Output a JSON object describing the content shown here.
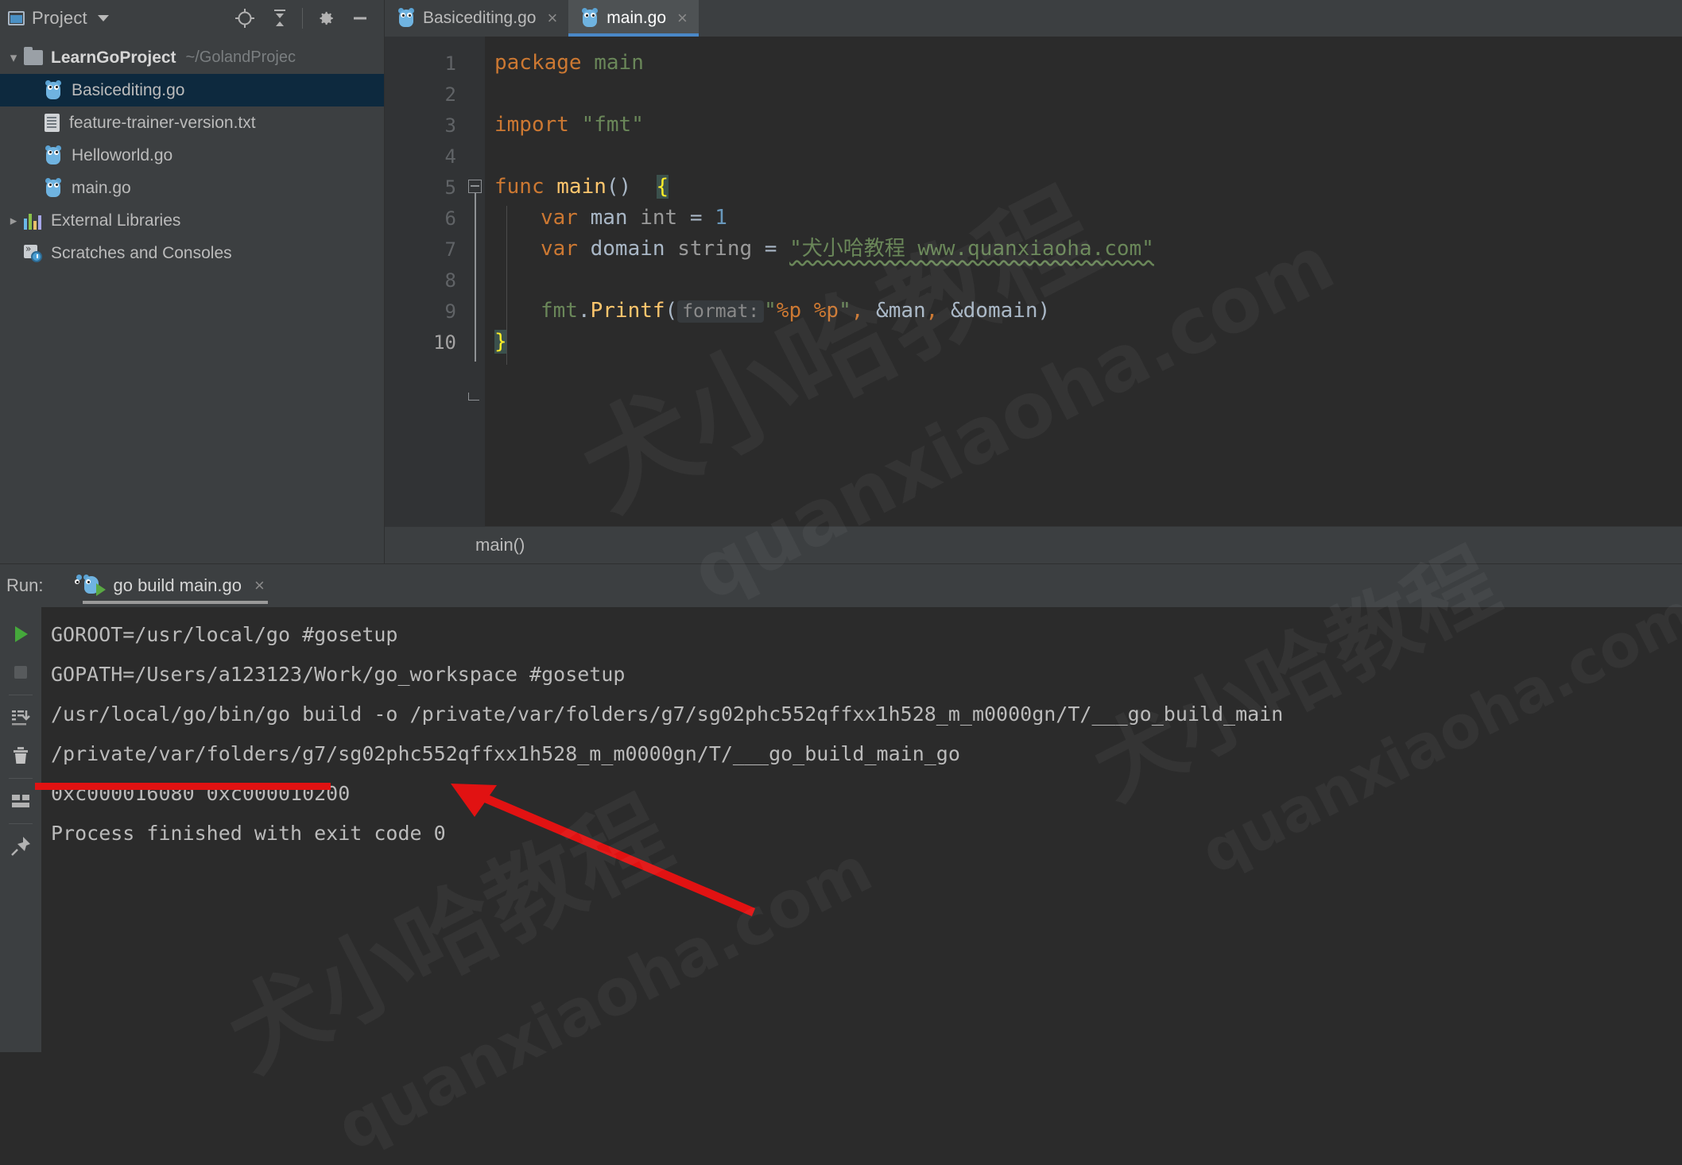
{
  "window": {
    "project_panel_title": "Project",
    "project_panel_icon": "window-icon",
    "toolbar_icons": [
      "locate-icon",
      "collapse-all-icon",
      "gear-icon",
      "minimize-icon"
    ]
  },
  "sidebar": {
    "items": [
      {
        "label": "LearnGoProject",
        "path": "~/GolandProjec",
        "icon": "folder-icon",
        "expanded": true,
        "selected": false,
        "depth": 0
      },
      {
        "label": "Basicediting.go",
        "path": "",
        "icon": "go-file-icon",
        "expanded": false,
        "selected": true,
        "depth": 1
      },
      {
        "label": "feature-trainer-version.txt",
        "path": "",
        "icon": "text-file-icon",
        "expanded": false,
        "selected": false,
        "depth": 1
      },
      {
        "label": "Helloworld.go",
        "path": "",
        "icon": "go-file-icon",
        "expanded": false,
        "selected": false,
        "depth": 1
      },
      {
        "label": "main.go",
        "path": "",
        "icon": "go-file-icon",
        "expanded": false,
        "selected": false,
        "depth": 1
      },
      {
        "label": "External Libraries",
        "path": "",
        "icon": "library-icon",
        "expanded": false,
        "selected": false,
        "depth": 0
      },
      {
        "label": "Scratches and Consoles",
        "path": "",
        "icon": "scratches-icon",
        "expanded": false,
        "selected": false,
        "depth": 0
      }
    ]
  },
  "editor": {
    "tabs": [
      {
        "label": "Basicediting.go",
        "icon": "go-file-icon",
        "active": false,
        "close": "×"
      },
      {
        "label": "main.go",
        "icon": "go-file-icon",
        "active": true,
        "close": "×"
      }
    ],
    "line_numbers": [
      "1",
      "2",
      "3",
      "4",
      "5",
      "6",
      "7",
      "8",
      "9",
      "10"
    ],
    "current_line": "10",
    "run_marker_line": "5",
    "breadcrumb": "main()",
    "code": {
      "l1_kw": "package",
      "l1_name": " main",
      "l3_kw": "import",
      "l3_str": " \"fmt\"",
      "l5_kw": "func",
      "l5_fn": " main",
      "l5_parens": "()",
      "l5_brace": "{",
      "l6_kw": "var",
      "l6_id": " man ",
      "l6_type": "int",
      "l6_eq": " = ",
      "l6_num": "1",
      "l7_kw": "var",
      "l7_id": " domain ",
      "l7_type": "string",
      "l7_eq": " = ",
      "l7_str": "\"犬小哈教程 www.quanxiaoha.com\"",
      "l9_pkg": "fmt",
      "l9_dot": ".",
      "l9_fn": "Printf",
      "l9_open": "(",
      "l9_hint": "format:",
      "l9_q1": "\"",
      "l9_p1": "%p",
      "l9_space": " ",
      "l9_p2": "%p",
      "l9_q2": "\"",
      "l9_comma": ", ",
      "l9_arg1": "&man",
      "l9_comma2": ", ",
      "l9_arg2": "&domain",
      "l9_close": ")",
      "l10_brace": "}"
    }
  },
  "run_panel": {
    "label": "Run:",
    "tab_label": "go build main.go",
    "tab_close": "×",
    "sidebar_icons": [
      "rerun-icon",
      "stop-icon",
      "scroll-to-end-icon",
      "trash-icon",
      "layout-icon",
      "pin-icon"
    ],
    "console_lines": [
      "GOROOT=/usr/local/go #gosetup",
      "GOPATH=/Users/a123123/Work/go_workspace #gosetup",
      "/usr/local/go/bin/go build -o /private/var/folders/g7/sg02phc552qffxx1h528_m_m0000gn/T/___go_build_main",
      "/private/var/folders/g7/sg02phc552qffxx1h528_m_m0000gn/T/___go_build_main_go",
      "0xc000016080 0xc000010200",
      "Process finished with exit code 0"
    ],
    "highlighted_line_index": 4,
    "annotation": {
      "underline_color": "#e11212",
      "arrow_color": "#e11212"
    }
  },
  "watermarks": [
    "犬小哈教程",
    "quanxiaoha.com",
    "犬小哈教程",
    "quanxiaoha.com",
    "犬小哈教程",
    "quanxiaoha.com"
  ],
  "colors": {
    "accent": "#4a88c7",
    "keyword": "#cc7832",
    "string": "#6a8759",
    "function": "#ffc66d",
    "number": "#6897bb",
    "identifier": "#a9b7c6",
    "annotation_red": "#e11212",
    "run_green": "#4a9c33"
  }
}
